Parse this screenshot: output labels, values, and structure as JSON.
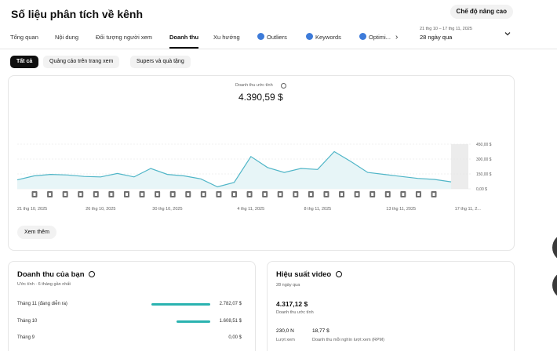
{
  "header": {
    "title": "Số liệu phân tích về kênh",
    "advanced_mode": "Chế độ nâng cao"
  },
  "tabs": [
    {
      "label": "Tổng quan"
    },
    {
      "label": "Nội dung"
    },
    {
      "label": "Đối tượng người xem"
    },
    {
      "label": "Doanh thu"
    },
    {
      "label": "Xu hướng"
    },
    {
      "label": "Outliers"
    },
    {
      "label": "Keywords"
    },
    {
      "label": "Optimi..."
    }
  ],
  "date_range": {
    "sub": "21 thg 10 – 17 thg 11, 2025",
    "main": "28 ngày qua"
  },
  "chips": [
    {
      "label": "Tất cả"
    },
    {
      "label": "Quảng cáo trên trang xem"
    },
    {
      "label": "Supers và quà tặng"
    }
  ],
  "metric": {
    "label": "Doanh thu ước tính",
    "value": "4.390,59 $"
  },
  "chart_data": {
    "type": "area",
    "color": "#4fb5c7",
    "fill": "#e7f5f7",
    "values": [
      90,
      130,
      145,
      140,
      125,
      120,
      155,
      120,
      205,
      145,
      130,
      100,
      20,
      65,
      325,
      215,
      165,
      205,
      195,
      375,
      275,
      165,
      145,
      125,
      105,
      95,
      70
    ],
    "ylim": [
      0,
      450
    ],
    "y_ticks": [
      {
        "v": 450,
        "label": "450,00 $"
      },
      {
        "v": 300,
        "label": "300,00 $"
      },
      {
        "v": 150,
        "label": "150,00 $"
      },
      {
        "v": 0,
        "label": "0,00 $"
      }
    ],
    "x_ticks": [
      {
        "i": 0,
        "label": "21 thg 10, 2025"
      },
      {
        "i": 5,
        "label": "26 thg 10, 2025"
      },
      {
        "i": 9,
        "label": "30 thg 10, 2025"
      },
      {
        "i": 14,
        "label": "4 thg 11, 2025"
      },
      {
        "i": 18,
        "label": "8 thg 11, 2025"
      },
      {
        "i": 23,
        "label": "13 thg 11, 2025"
      },
      {
        "i": 27,
        "label": "17 thg 11, 2..."
      }
    ],
    "marker_count": 27
  },
  "see_more": "Xem thêm",
  "revenue": {
    "title": "Doanh thu của bạn",
    "subtitle": "Ước tính · 6 tháng gần nhất",
    "months": [
      {
        "label": "Tháng 11 (đang diễn ra)",
        "value": "2.782,07 $",
        "amount": 2782.07
      },
      {
        "label": "Tháng 10",
        "value": "1.608,51 $",
        "amount": 1608.51
      },
      {
        "label": "Tháng 9",
        "value": "0,00 $",
        "amount": 0
      }
    ],
    "max_amount": 2782.07
  },
  "video_perf": {
    "title": "Hiệu suất video",
    "subtitle": "28 ngày qua",
    "value": "4.317,12 $",
    "value_label": "Doanh thu ước tính",
    "views": "230,0 N",
    "views_label": "Lượt xem",
    "rpm": "18,77 $",
    "rpm_label": "Doanh thu mỗi nghìn lượt xem (RPM)"
  }
}
